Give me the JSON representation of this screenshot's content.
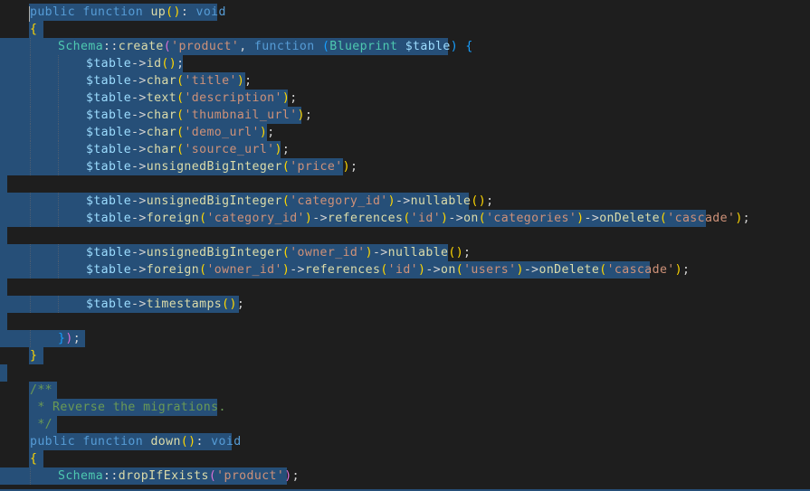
{
  "editor": {
    "language": "php",
    "colors": {
      "background": "#1e1e1e",
      "selection": "#264f78",
      "keyword": "#569cd6",
      "function": "#dcdcaa",
      "variable": "#9cdcfe",
      "class": "#4ec9b0",
      "string": "#ce9178",
      "comment": "#6a9955",
      "punctuation": "#d4d4d4"
    },
    "lines": [
      {
        "indent": 0,
        "tokens": [
          [
            "kw",
            "public function "
          ],
          [
            "fn",
            "up"
          ],
          [
            "br1",
            "()"
          ],
          [
            "pun",
            ": "
          ],
          [
            "kw",
            "void"
          ]
        ]
      },
      {
        "indent": 0,
        "tokens": [
          [
            "br1",
            "{"
          ]
        ]
      },
      {
        "indent": 1,
        "tokens": [
          [
            "cls",
            "Schema"
          ],
          [
            "pun",
            "::"
          ],
          [
            "fn",
            "create"
          ],
          [
            "br2",
            "("
          ],
          [
            "str",
            "'product'"
          ],
          [
            "pun",
            ", "
          ],
          [
            "kw",
            "function "
          ],
          [
            "br3",
            "("
          ],
          [
            "cls",
            "Blueprint "
          ],
          [
            "var",
            "$table"
          ],
          [
            "br3",
            ")"
          ],
          [
            "pun",
            " "
          ],
          [
            "br3",
            "{"
          ]
        ]
      },
      {
        "indent": 2,
        "tokens": [
          [
            "var",
            "$table"
          ],
          [
            "pun",
            "->"
          ],
          [
            "fn",
            "id"
          ],
          [
            "br1",
            "()"
          ],
          [
            "pun",
            ";"
          ]
        ]
      },
      {
        "indent": 2,
        "tokens": [
          [
            "var",
            "$table"
          ],
          [
            "pun",
            "->"
          ],
          [
            "fn",
            "char"
          ],
          [
            "br1",
            "("
          ],
          [
            "str",
            "'title'"
          ],
          [
            "br1",
            ")"
          ],
          [
            "pun",
            ";"
          ]
        ]
      },
      {
        "indent": 2,
        "tokens": [
          [
            "var",
            "$table"
          ],
          [
            "pun",
            "->"
          ],
          [
            "fn",
            "text"
          ],
          [
            "br1",
            "("
          ],
          [
            "str",
            "'description'"
          ],
          [
            "br1",
            ")"
          ],
          [
            "pun",
            ";"
          ]
        ]
      },
      {
        "indent": 2,
        "tokens": [
          [
            "var",
            "$table"
          ],
          [
            "pun",
            "->"
          ],
          [
            "fn",
            "char"
          ],
          [
            "br1",
            "("
          ],
          [
            "str",
            "'thumbnail_url'"
          ],
          [
            "br1",
            ")"
          ],
          [
            "pun",
            ";"
          ]
        ]
      },
      {
        "indent": 2,
        "tokens": [
          [
            "var",
            "$table"
          ],
          [
            "pun",
            "->"
          ],
          [
            "fn",
            "char"
          ],
          [
            "br1",
            "("
          ],
          [
            "str",
            "'demo_url'"
          ],
          [
            "br1",
            ")"
          ],
          [
            "pun",
            ";"
          ]
        ]
      },
      {
        "indent": 2,
        "tokens": [
          [
            "var",
            "$table"
          ],
          [
            "pun",
            "->"
          ],
          [
            "fn",
            "char"
          ],
          [
            "br1",
            "("
          ],
          [
            "str",
            "'source_url'"
          ],
          [
            "br1",
            ")"
          ],
          [
            "pun",
            ";"
          ]
        ]
      },
      {
        "indent": 2,
        "tokens": [
          [
            "var",
            "$table"
          ],
          [
            "pun",
            "->"
          ],
          [
            "fn",
            "unsignedBigInteger"
          ],
          [
            "br1",
            "("
          ],
          [
            "str",
            "'price'"
          ],
          [
            "br1",
            ")"
          ],
          [
            "pun",
            ";"
          ]
        ]
      },
      {
        "indent": 0,
        "tokens": []
      },
      {
        "indent": 2,
        "tokens": [
          [
            "var",
            "$table"
          ],
          [
            "pun",
            "->"
          ],
          [
            "fn",
            "unsignedBigInteger"
          ],
          [
            "br1",
            "("
          ],
          [
            "str",
            "'category_id'"
          ],
          [
            "br1",
            ")"
          ],
          [
            "pun",
            "->"
          ],
          [
            "fn",
            "nullable"
          ],
          [
            "br1",
            "()"
          ],
          [
            "pun",
            ";"
          ]
        ]
      },
      {
        "indent": 2,
        "tokens": [
          [
            "var",
            "$table"
          ],
          [
            "pun",
            "->"
          ],
          [
            "fn",
            "foreign"
          ],
          [
            "br1",
            "("
          ],
          [
            "str",
            "'category_id'"
          ],
          [
            "br1",
            ")"
          ],
          [
            "pun",
            "->"
          ],
          [
            "fn",
            "references"
          ],
          [
            "br1",
            "("
          ],
          [
            "str",
            "'id'"
          ],
          [
            "br1",
            ")"
          ],
          [
            "pun",
            "->"
          ],
          [
            "fn",
            "on"
          ],
          [
            "br1",
            "("
          ],
          [
            "str",
            "'categories'"
          ],
          [
            "br1",
            ")"
          ],
          [
            "pun",
            "->"
          ],
          [
            "fn",
            "onDelete"
          ],
          [
            "br1",
            "("
          ],
          [
            "str",
            "'cascade'"
          ],
          [
            "br1",
            ")"
          ],
          [
            "pun",
            ";"
          ]
        ]
      },
      {
        "indent": 0,
        "tokens": []
      },
      {
        "indent": 2,
        "tokens": [
          [
            "var",
            "$table"
          ],
          [
            "pun",
            "->"
          ],
          [
            "fn",
            "unsignedBigInteger"
          ],
          [
            "br1",
            "("
          ],
          [
            "str",
            "'owner_id'"
          ],
          [
            "br1",
            ")"
          ],
          [
            "pun",
            "->"
          ],
          [
            "fn",
            "nullable"
          ],
          [
            "br1",
            "()"
          ],
          [
            "pun",
            ";"
          ]
        ]
      },
      {
        "indent": 2,
        "tokens": [
          [
            "var",
            "$table"
          ],
          [
            "pun",
            "->"
          ],
          [
            "fn",
            "foreign"
          ],
          [
            "br1",
            "("
          ],
          [
            "str",
            "'owner_id'"
          ],
          [
            "br1",
            ")"
          ],
          [
            "pun",
            "->"
          ],
          [
            "fn",
            "references"
          ],
          [
            "br1",
            "("
          ],
          [
            "str",
            "'id'"
          ],
          [
            "br1",
            ")"
          ],
          [
            "pun",
            "->"
          ],
          [
            "fn",
            "on"
          ],
          [
            "br1",
            "("
          ],
          [
            "str",
            "'users'"
          ],
          [
            "br1",
            ")"
          ],
          [
            "pun",
            "->"
          ],
          [
            "fn",
            "onDelete"
          ],
          [
            "br1",
            "("
          ],
          [
            "str",
            "'cascade'"
          ],
          [
            "br1",
            ")"
          ],
          [
            "pun",
            ";"
          ]
        ]
      },
      {
        "indent": 0,
        "tokens": []
      },
      {
        "indent": 2,
        "tokens": [
          [
            "var",
            "$table"
          ],
          [
            "pun",
            "->"
          ],
          [
            "fn",
            "timestamps"
          ],
          [
            "br1",
            "()"
          ],
          [
            "pun",
            ";"
          ]
        ]
      },
      {
        "indent": 0,
        "tokens": []
      },
      {
        "indent": 1,
        "tokens": [
          [
            "br3",
            "}"
          ],
          [
            "br2",
            ")"
          ],
          [
            "pun",
            ";"
          ]
        ]
      },
      {
        "indent": 0,
        "tokens": [
          [
            "br1",
            "}"
          ]
        ]
      },
      {
        "indent": 0,
        "tokens": []
      },
      {
        "indent": 0,
        "tokens": [
          [
            "cm",
            "/**"
          ]
        ]
      },
      {
        "indent": 0,
        "tokens": [
          [
            "cm",
            " * Reverse the migrations."
          ]
        ]
      },
      {
        "indent": 0,
        "tokens": [
          [
            "cm",
            " */"
          ]
        ]
      },
      {
        "indent": 0,
        "tokens": [
          [
            "kw",
            "public function "
          ],
          [
            "fn",
            "down"
          ],
          [
            "br1",
            "()"
          ],
          [
            "pun",
            ": "
          ],
          [
            "kw",
            "void"
          ]
        ]
      },
      {
        "indent": 0,
        "tokens": [
          [
            "br1",
            "{"
          ]
        ]
      },
      {
        "indent": 1,
        "tokens": [
          [
            "cls",
            "Schema"
          ],
          [
            "pun",
            "::"
          ],
          [
            "fn",
            "dropIfExists"
          ],
          [
            "br2",
            "("
          ],
          [
            "str",
            "'product'"
          ],
          [
            "br2",
            ")"
          ],
          [
            "pun",
            ";"
          ]
        ]
      }
    ]
  }
}
